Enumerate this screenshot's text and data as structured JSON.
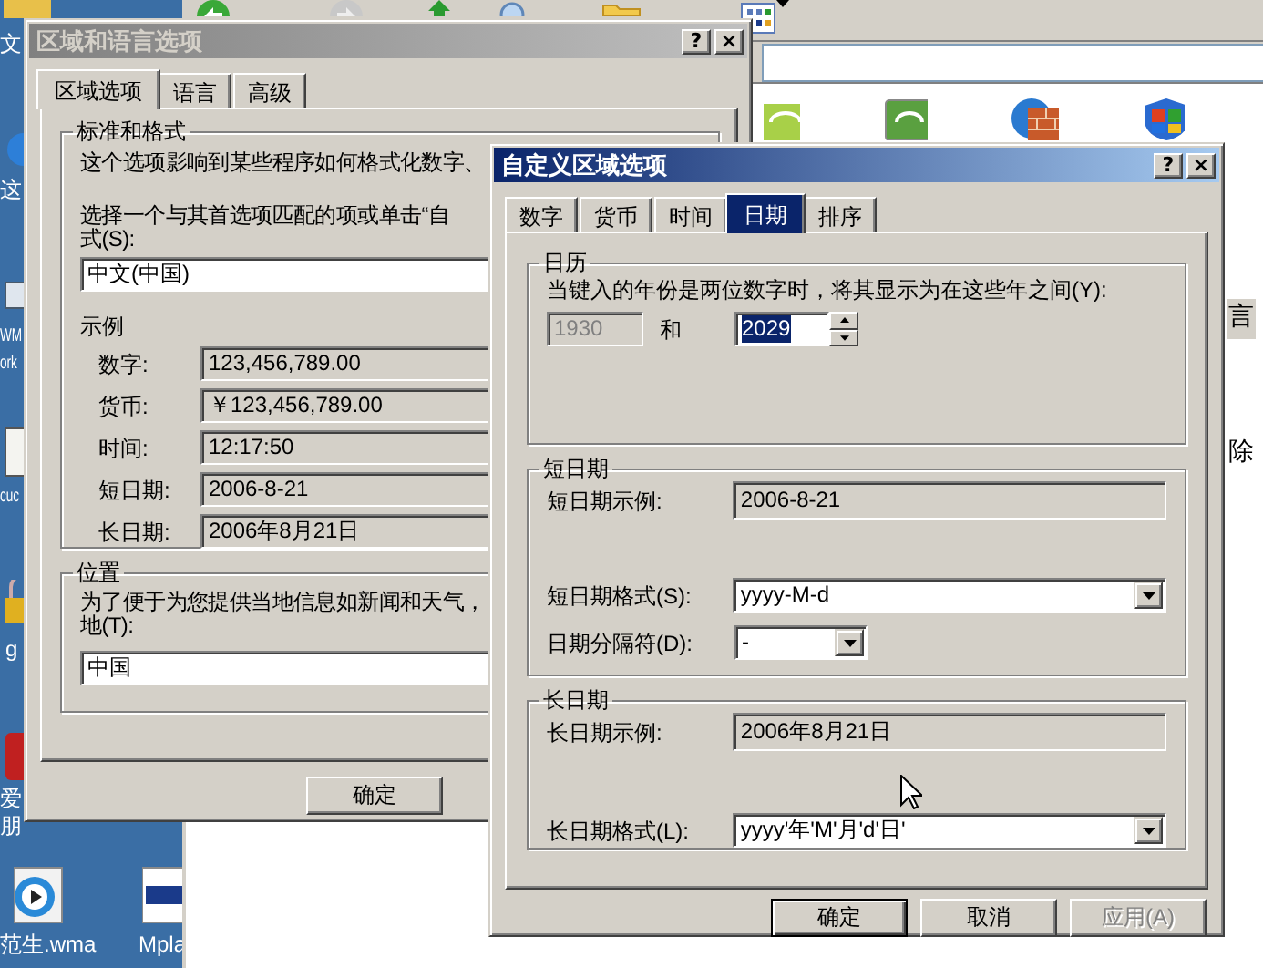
{
  "desktop": {
    "icons": [
      {
        "label": "文"
      },
      {
        "label": "这"
      },
      {
        "label": "WM"
      },
      {
        "label": "ork"
      },
      {
        "label": "cuc"
      },
      {
        "label": "g"
      },
      {
        "label": "爱"
      },
      {
        "label": "朋"
      },
      {
        "label": "范生.wma"
      },
      {
        "label": "Mpla"
      }
    ]
  },
  "explorer": {
    "side_texts": [
      "言",
      "除"
    ]
  },
  "region_dialog": {
    "title": "区域和语言选项",
    "active": false,
    "caption_buttons": [
      "?",
      "×"
    ],
    "tabs": [
      {
        "label": "区域选项",
        "selected": true
      },
      {
        "label": "语言",
        "selected": false
      },
      {
        "label": "高级",
        "selected": false
      }
    ],
    "standards": {
      "title": "标准和格式",
      "description": "这个选项影响到某些程序如何格式化数字、",
      "prompt": "选择一个与其首选项匹配的项或单击“自",
      "prompt_line2": "式(S):",
      "format": "中文(中国)",
      "samples_title": "示例",
      "samples": [
        {
          "label": "数字:",
          "value": "123,456,789.00"
        },
        {
          "label": "货币:",
          "value": "￥123,456,789.00"
        },
        {
          "label": "时间:",
          "value": "12:17:50"
        },
        {
          "label": "短日期:",
          "value": "2006-8-21"
        },
        {
          "label": "长日期:",
          "value": "2006年8月21日"
        }
      ]
    },
    "location": {
      "title": "位置",
      "description": "为了便于为您提供当地信息如新闻和天气，",
      "description_line2": "地(T):",
      "value": "中国"
    },
    "buttons": [
      {
        "label": "确定"
      }
    ]
  },
  "custom_dialog": {
    "title": "自定义区域选项",
    "active": true,
    "caption_buttons": [
      "?",
      "×"
    ],
    "tabs": [
      {
        "label": "数字",
        "selected": false
      },
      {
        "label": "货币",
        "selected": false
      },
      {
        "label": "时间",
        "selected": false
      },
      {
        "label": "日期",
        "selected": true
      },
      {
        "label": "排序",
        "selected": false
      }
    ],
    "calendar": {
      "title": "日历",
      "description": "当键入的年份是两位数字时，将其显示为在这些年之间(Y):",
      "from_year": {
        "value": "1930",
        "disabled": true
      },
      "conjunction": "和",
      "to_year": {
        "value": "2029",
        "selected": true
      }
    },
    "short_date": {
      "title": "短日期",
      "sample_label": "短日期示例:",
      "sample": "2006-8-21",
      "format_label": "短日期格式(S):",
      "format": "yyyy-M-d",
      "separator_label": "日期分隔符(D):",
      "separator": "-"
    },
    "long_date": {
      "title": "长日期",
      "sample_label": "长日期示例:",
      "sample": "2006年8月21日",
      "format_label": "长日期格式(L):",
      "format": "yyyy'年'M'月'd'日'"
    },
    "buttons": [
      {
        "label": "确定",
        "default": true,
        "disabled": false
      },
      {
        "label": "取消",
        "default": false,
        "disabled": false
      },
      {
        "label": "应用(A)",
        "default": false,
        "disabled": true
      }
    ]
  }
}
